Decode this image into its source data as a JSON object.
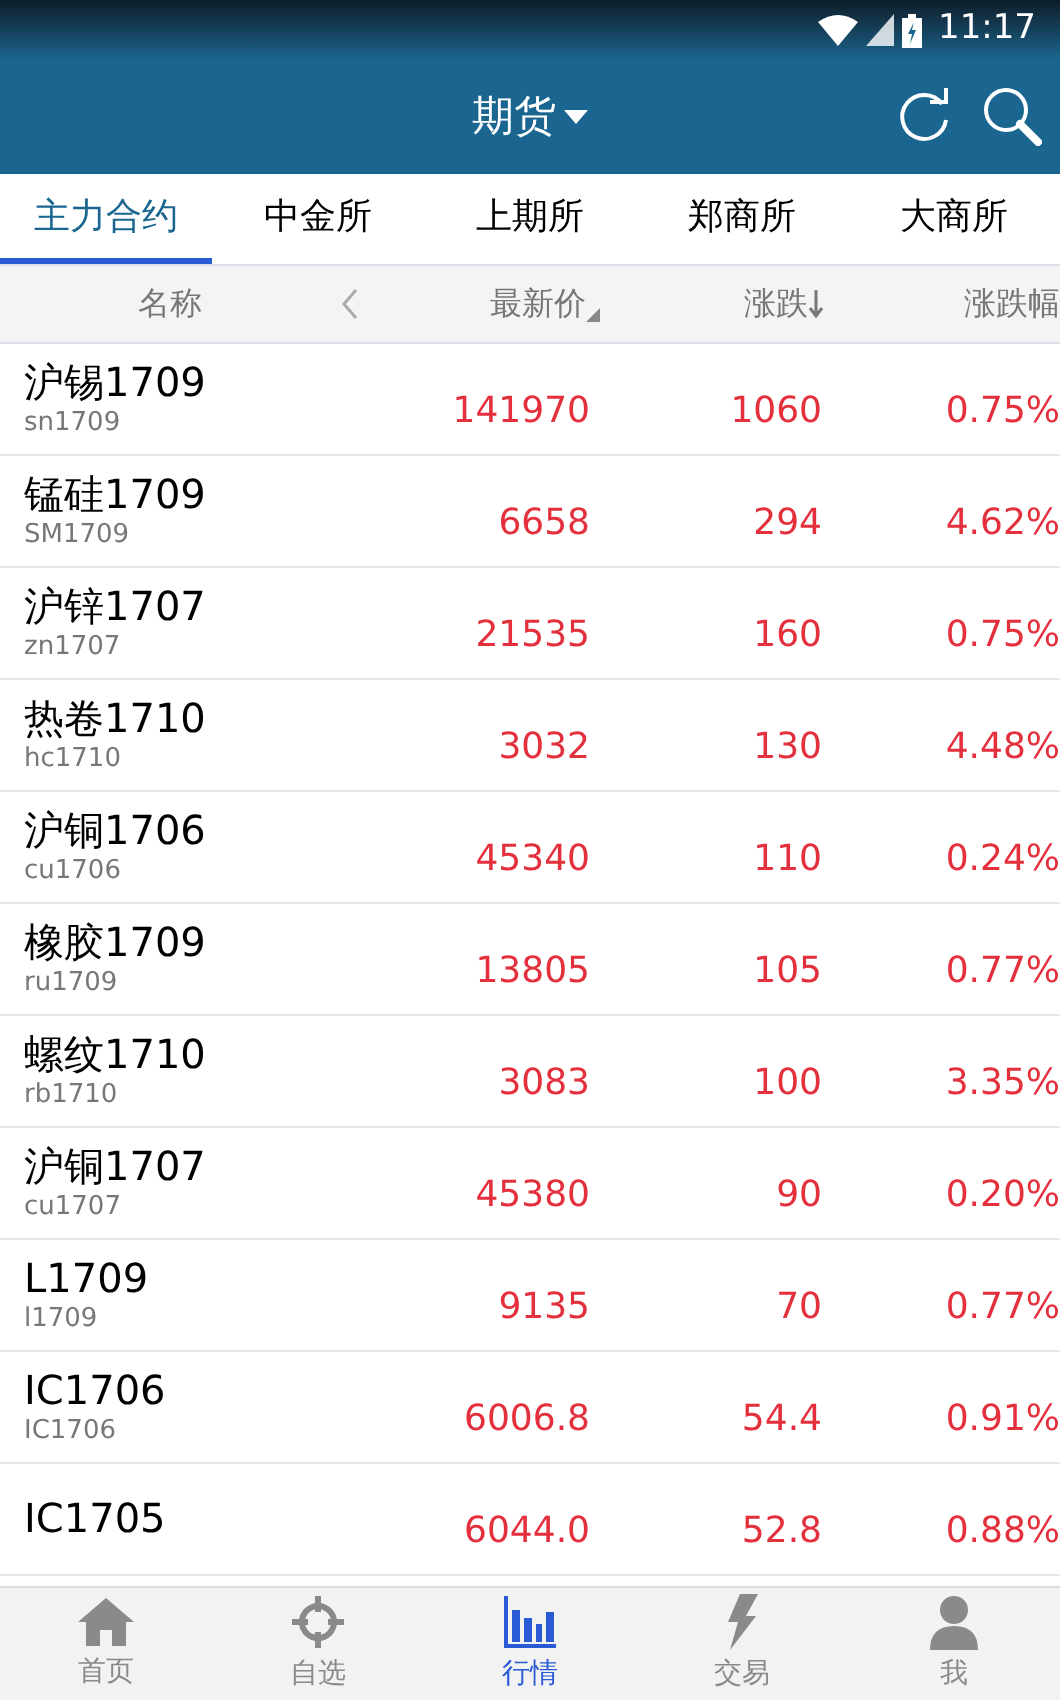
{
  "status_bar": {
    "time": "11:17"
  },
  "header": {
    "title": "期货"
  },
  "tabs": [
    {
      "label": "主力合约",
      "selected": true
    },
    {
      "label": "中金所",
      "selected": false
    },
    {
      "label": "上期所",
      "selected": false
    },
    {
      "label": "郑商所",
      "selected": false
    },
    {
      "label": "大商所",
      "selected": false
    }
  ],
  "table": {
    "columns": [
      {
        "label": "名称",
        "kind": "plain"
      },
      {
        "label": "最新价",
        "kind": "triangle"
      },
      {
        "label": "涨跌",
        "kind": "down"
      },
      {
        "label": "涨跌幅",
        "kind": "plain"
      }
    ],
    "rows": [
      {
        "name": "沪锡1709",
        "code": "sn1709",
        "price": "141970",
        "change": "1060",
        "pct": "0.75%"
      },
      {
        "name": "锰硅1709",
        "code": "SM1709",
        "price": "6658",
        "change": "294",
        "pct": "4.62%"
      },
      {
        "name": "沪锌1707",
        "code": "zn1707",
        "price": "21535",
        "change": "160",
        "pct": "0.75%"
      },
      {
        "name": "热卷1710",
        "code": "hc1710",
        "price": "3032",
        "change": "130",
        "pct": "4.48%"
      },
      {
        "name": "沪铜1706",
        "code": "cu1706",
        "price": "45340",
        "change": "110",
        "pct": "0.24%"
      },
      {
        "name": "橡胶1709",
        "code": "ru1709",
        "price": "13805",
        "change": "105",
        "pct": "0.77%"
      },
      {
        "name": "螺纹1710",
        "code": "rb1710",
        "price": "3083",
        "change": "100",
        "pct": "3.35%"
      },
      {
        "name": "沪铜1707",
        "code": "cu1707",
        "price": "45380",
        "change": "90",
        "pct": "0.20%"
      },
      {
        "name": "L1709",
        "code": "l1709",
        "price": "9135",
        "change": "70",
        "pct": "0.77%"
      },
      {
        "name": "IC1706",
        "code": "IC1706",
        "price": "6006.8",
        "change": "54.4",
        "pct": "0.91%"
      },
      {
        "name": "IC1705",
        "price": "6044.0",
        "change": "52.8",
        "pct": "0.88%"
      }
    ]
  },
  "bottom_nav": [
    {
      "label": "首页",
      "kind": "home",
      "selected": false
    },
    {
      "label": "自选",
      "kind": "target",
      "selected": false
    },
    {
      "label": "行情",
      "kind": "chart",
      "selected": true
    },
    {
      "label": "交易",
      "kind": "bolt",
      "selected": false
    },
    {
      "label": "我",
      "kind": "user",
      "selected": false
    }
  ]
}
